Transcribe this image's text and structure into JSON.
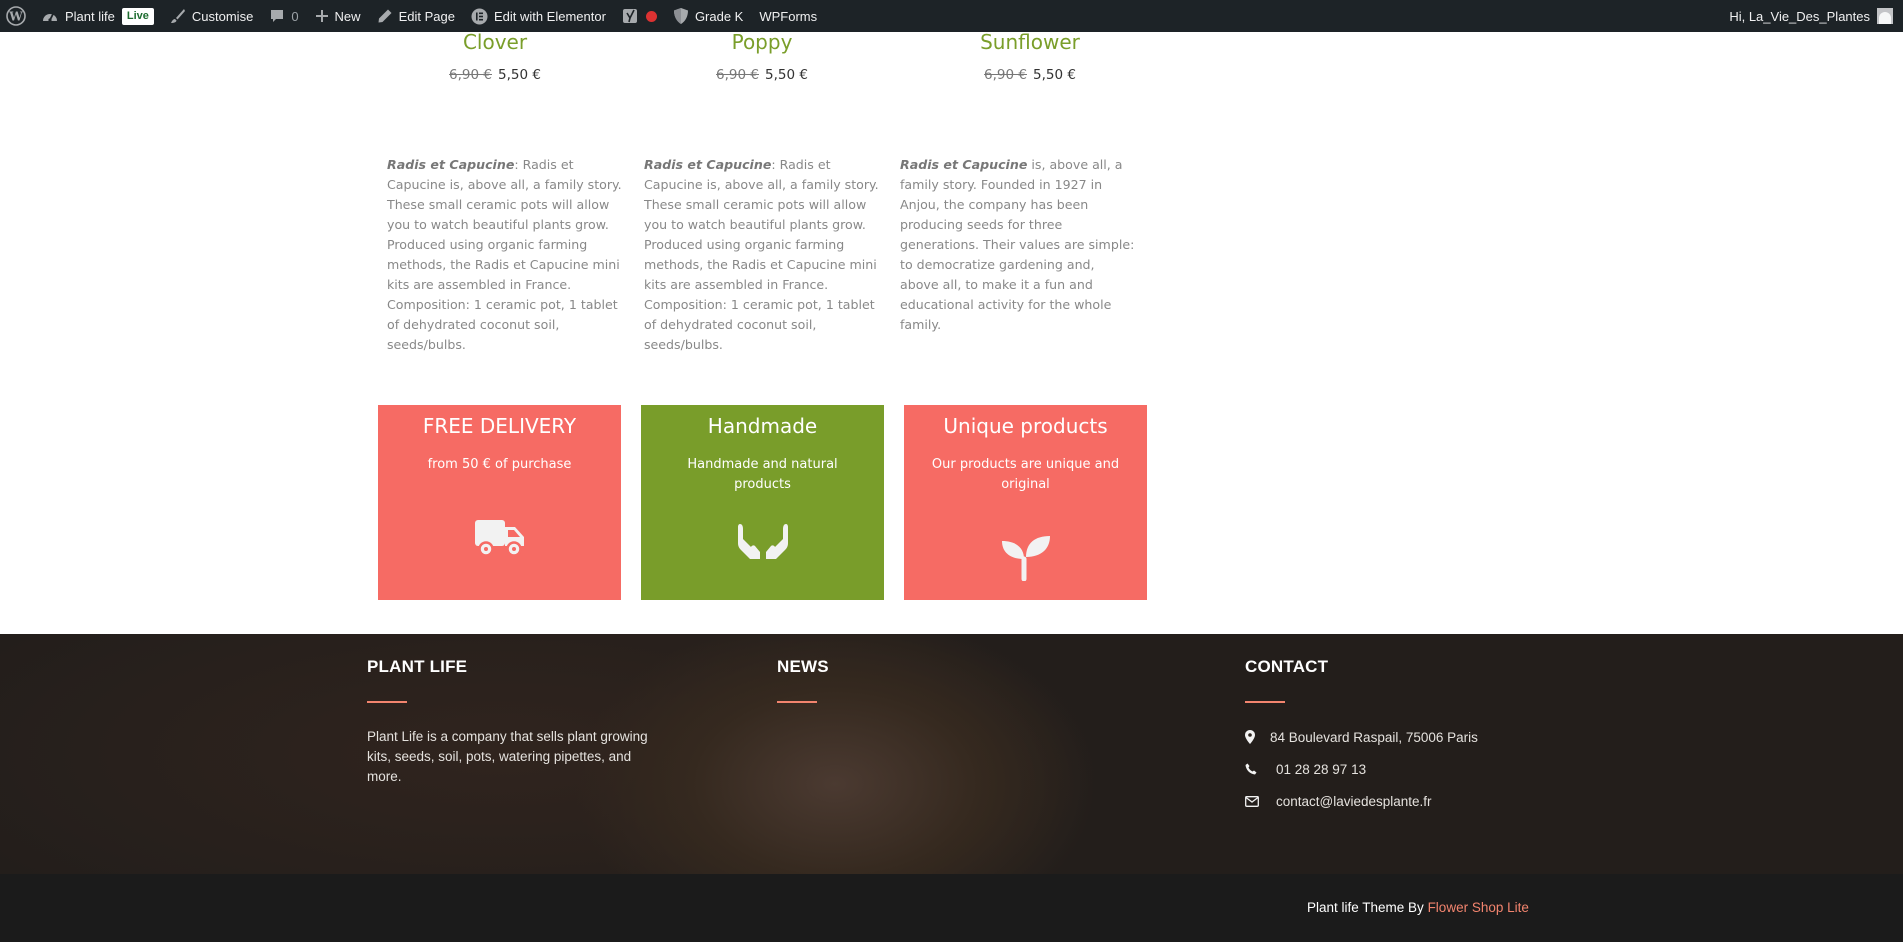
{
  "adminbar": {
    "site_name": "Plant life",
    "live_badge": "Live",
    "customise": "Customise",
    "comments_count": "0",
    "new": "New",
    "edit_page": "Edit Page",
    "edit_elementor": "Edit with Elementor",
    "grade": "Grade K",
    "wpforms": "WPForms",
    "greeting": "Hi, La_Vie_Des_Plantes"
  },
  "products": [
    {
      "name": "Clover",
      "old_price": "6,90 €",
      "price": "5,50 €"
    },
    {
      "name": "Poppy",
      "old_price": "6,90 €",
      "price": "5,50 €"
    },
    {
      "name": "Sunflower",
      "old_price": "6,90 €",
      "price": "5,50 €"
    }
  ],
  "descriptions": [
    {
      "brand": "Radis et Capucine",
      "text": ": Radis et Capucine is, above all, a family story. These small ceramic pots will allow you to watch beautiful plants grow. Produced using organic farming methods, the Radis et Capucine mini kits are assembled in France. Composition: 1 ceramic pot, 1 tablet of dehydrated coconut soil, seeds/bulbs."
    },
    {
      "brand": "Radis et Capucine",
      "text": ": Radis et Capucine is, above all, a family story. These small ceramic pots will allow you to watch beautiful plants grow. Produced using organic farming methods, the Radis et Capucine mini kits are assembled in France. Composition: 1 ceramic pot, 1 tablet of dehydrated coconut soil, seeds/bulbs."
    },
    {
      "brand": "Radis et Capucine",
      "text": " is, above all, a family story. Founded in 1927 in Anjou, the company has been producing seeds for three generations. Their values are simple: to democratize gardening and, above all, to make it a fun and educational activity for the whole family."
    }
  ],
  "features": [
    {
      "title": "FREE DELIVERY",
      "text": "from 50 € of purchase",
      "icon": "truck-icon",
      "color": "#f66b64"
    },
    {
      "title": "Handmade",
      "text": "Handmade and natural products",
      "icon": "hands-icon",
      "color": "#799d2a"
    },
    {
      "title": "Unique products",
      "text": "Our products are unique and original",
      "icon": "seedling-icon",
      "color": "#f66b64"
    }
  ],
  "footer": {
    "about_heading": "PLANT LIFE",
    "about_text": "Plant Life is a company that sells plant growing kits, seeds, soil, pots, watering pipettes, and more.",
    "news_heading": "NEWS",
    "contact_heading": "CONTACT",
    "address": "84 Boulevard Raspail, 75006 Paris",
    "phone": "01 28 28 97 13",
    "email": "contact@laviedesplante.fr",
    "accent_color": "#f2846e"
  },
  "copyright": {
    "text": "Plant life Theme By ",
    "link": "Flower Shop Lite"
  }
}
